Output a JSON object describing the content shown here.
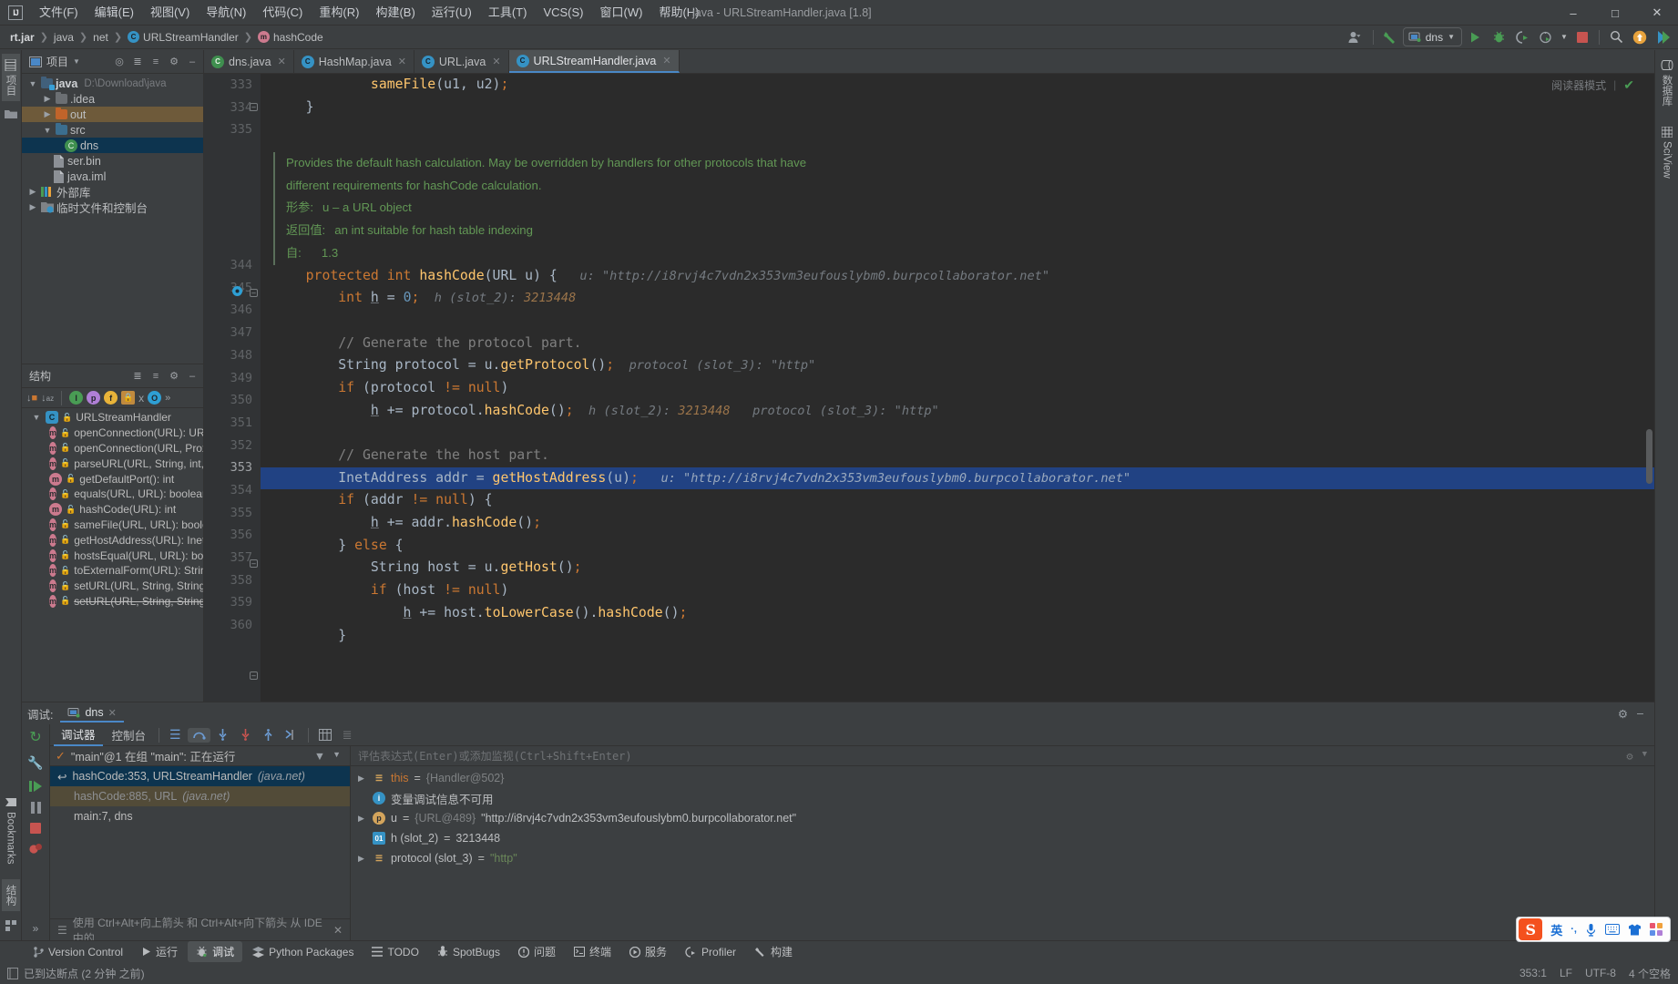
{
  "window": {
    "title": "java - URLStreamHandler.java [1.8]",
    "minimize": "–",
    "maximize": "□",
    "close": "✕"
  },
  "menu": [
    {
      "label": "文件(F)"
    },
    {
      "label": "编辑(E)"
    },
    {
      "label": "视图(V)"
    },
    {
      "label": "导航(N)"
    },
    {
      "label": "代码(C)"
    },
    {
      "label": "重构(R)"
    },
    {
      "label": "构建(B)"
    },
    {
      "label": "运行(U)"
    },
    {
      "label": "工具(T)"
    },
    {
      "label": "VCS(S)"
    },
    {
      "label": "窗口(W)"
    },
    {
      "label": "帮助(H)"
    }
  ],
  "breadcrumbs": [
    {
      "label": "rt.jar",
      "icon": "",
      "bold": true
    },
    {
      "label": "java",
      "icon": "",
      "bold": false
    },
    {
      "label": "net",
      "icon": "",
      "bold": false
    },
    {
      "label": "URLStreamHandler",
      "icon": "C",
      "bold": false
    },
    {
      "label": "hashCode",
      "icon": "m",
      "bold": false
    }
  ],
  "toolbar": {
    "run_config": "dns",
    "run_tooltip": "运行",
    "debug_tooltip": "调试",
    "stop_tooltip": "停止",
    "search_tooltip": "搜索"
  },
  "left_rail": {
    "top": "项目",
    "bookmarks": "Bookmarks",
    "structure": "结构"
  },
  "right_rail": {
    "database": "数据库",
    "sciview": "SciView"
  },
  "project": {
    "title": "项目",
    "rows": [
      {
        "indent": 0,
        "arrow": "v",
        "icon": "folder-module",
        "label": "java",
        "bold": true,
        "path": "D:\\Download\\java",
        "state": ""
      },
      {
        "indent": 1,
        "arrow": ">",
        "icon": "folder",
        "label": ".idea",
        "bold": false,
        "path": "",
        "state": ""
      },
      {
        "indent": 1,
        "arrow": ">",
        "icon": "folder-out",
        "label": "out",
        "bold": false,
        "path": "",
        "state": "sel-orange"
      },
      {
        "indent": 1,
        "arrow": "v",
        "icon": "folder-src",
        "label": "src",
        "bold": false,
        "path": "",
        "state": ""
      },
      {
        "indent": 2,
        "arrow": "",
        "icon": "java-class",
        "label": "dns",
        "bold": false,
        "path": "",
        "state": "sel-blue"
      },
      {
        "indent": 1,
        "arrow": "",
        "icon": "file-bin",
        "label": "ser.bin",
        "bold": false,
        "path": "",
        "state": ""
      },
      {
        "indent": 1,
        "arrow": "",
        "icon": "file-iml",
        "label": "java.iml",
        "bold": false,
        "path": "",
        "state": ""
      },
      {
        "indent": 0,
        "arrow": ">",
        "icon": "library",
        "label": "外部库",
        "bold": false,
        "path": "",
        "state": ""
      },
      {
        "indent": 0,
        "arrow": ">",
        "icon": "scratch",
        "label": "临时文件和控制台",
        "bold": false,
        "path": "",
        "state": ""
      }
    ]
  },
  "structure": {
    "title": "结构",
    "class": "URLStreamHandler",
    "members": [
      {
        "label": "openConnection(URL): URLConnection",
        "strike": false
      },
      {
        "label": "openConnection(URL, Proxy): URLCo",
        "strike": false
      },
      {
        "label": "parseURL(URL, String, int, int): void",
        "strike": false
      },
      {
        "label": "getDefaultPort(): int",
        "strike": false
      },
      {
        "label": "equals(URL, URL): boolean",
        "strike": false
      },
      {
        "label": "hashCode(URL): int",
        "strike": false
      },
      {
        "label": "sameFile(URL, URL): boolean",
        "strike": false
      },
      {
        "label": "getHostAddress(URL): InetAddress",
        "strike": false
      },
      {
        "label": "hostsEqual(URL, URL): boolean",
        "strike": false
      },
      {
        "label": "toExternalForm(URL): String",
        "strike": false
      },
      {
        "label": "setURL(URL, String, String, int, S",
        "strike": false
      },
      {
        "label": "setURL(URL, String, String, int, S",
        "strike": true
      }
    ]
  },
  "editor": {
    "tabs": [
      {
        "label": "dns.java",
        "icon": "green",
        "active": false
      },
      {
        "label": "HashMap.java",
        "icon": "blue",
        "active": false
      },
      {
        "label": "URL.java",
        "icon": "blue",
        "active": false
      },
      {
        "label": "URLStreamHandler.java",
        "icon": "blue",
        "active": true
      }
    ],
    "reader_mode": "阅读器模式",
    "javadoc": {
      "line1": "Provides the default hash calculation. May be overridden by handlers for other protocols that have",
      "line2": "different requirements for hashCode calculation.",
      "param_key": "形参:",
      "param_val": "u – a URL object",
      "return_key": "返回值:",
      "return_val": "an int suitable for hash table indexing",
      "since_key": "自:",
      "since_val": "1.3"
    },
    "lines": [
      {
        "n": "333",
        "text": "            sameFile(u1, u2);"
      },
      {
        "n": "334",
        "text": "    }"
      },
      {
        "n": "335",
        "text": ""
      },
      {
        "n": "344",
        "text": "    protected int hashCode(URL u) {"
      },
      {
        "n": "345",
        "text": "        int h = 0;"
      },
      {
        "n": "346",
        "text": ""
      },
      {
        "n": "347",
        "text": "        // Generate the protocol part."
      },
      {
        "n": "348",
        "text": "        String protocol = u.getProtocol();"
      },
      {
        "n": "349",
        "text": "        if (protocol != null)"
      },
      {
        "n": "350",
        "text": "            h += protocol.hashCode();"
      },
      {
        "n": "351",
        "text": ""
      },
      {
        "n": "352",
        "text": "        // Generate the host part."
      },
      {
        "n": "353",
        "text": "        InetAddress addr = getHostAddress(u);"
      },
      {
        "n": "354",
        "text": "        if (addr != null) {"
      },
      {
        "n": "355",
        "text": "            h += addr.hashCode();"
      },
      {
        "n": "356",
        "text": "        } else {"
      },
      {
        "n": "357",
        "text": "            String host = u.getHost();"
      },
      {
        "n": "358",
        "text": "            if (host != null)"
      },
      {
        "n": "359",
        "text": "                h += host.toLowerCase().hashCode();"
      },
      {
        "n": "360",
        "text": "        }"
      }
    ],
    "inline_hints": {
      "u_label": "u:",
      "u_value": "\"http://i8rvj4c7vdn2x353vm3eufouslybm0.burpcollaborator.net\"",
      "h_label": "h (slot_2):",
      "h_value": "3213448",
      "protocol_label": "protocol (slot_3):",
      "protocol_value": "\"http\""
    }
  },
  "debug": {
    "panel_label": "调试:",
    "session_tab": "dns",
    "tab_debugger": "调试器",
    "tab_console": "控制台",
    "thread_status": "\"main\"@1 在组 \"main\": 正在运行",
    "frames": [
      {
        "label": "hashCode:353, URLStreamHandler",
        "suffix": "(java.net)",
        "state": "sel"
      },
      {
        "label": "hashCode:885, URL",
        "suffix": "(java.net)",
        "state": "lib"
      },
      {
        "label": "main:7, dns",
        "suffix": "",
        "state": ""
      }
    ],
    "eval_placeholder": "评估表达式(Enter)或添加监视(Ctrl+Shift+Enter)",
    "variables": [
      {
        "arrow": ">",
        "icon": "this",
        "iconcolor": "#d3a45c",
        "name": "this",
        "eq": "=",
        "ref": "{Handler@502}",
        "value": "",
        "color": "#cc7832"
      },
      {
        "arrow": "",
        "icon": "info",
        "iconcolor": "#3592c4",
        "name": "变量调试信息不可用",
        "eq": "",
        "ref": "",
        "value": "",
        "color": "#bcbec0"
      },
      {
        "arrow": ">",
        "icon": "param",
        "iconcolor": "#d3a45c",
        "name": "u",
        "eq": "=",
        "ref": "{URL@489}",
        "value": "\"http://i8rvj4c7vdn2x353vm3eufouslybm0.burpcollaborator.net\"",
        "color": "#bcbec0"
      },
      {
        "arrow": "",
        "icon": "prim",
        "iconcolor": "#3592c4",
        "name": "h (slot_2)",
        "eq": "=",
        "ref": "",
        "value": "3213448",
        "color": "#bcbec0"
      },
      {
        "arrow": ">",
        "icon": "this",
        "iconcolor": "#d3a45c",
        "name": "protocol (slot_3)",
        "eq": "=",
        "ref": "",
        "value": "\"http\"",
        "color": "#6a8759"
      }
    ],
    "tip": "使用 Ctrl+Alt+向上箭头 和 Ctrl+Alt+向下箭头 从 IDE 中的...",
    "tip_close": "✕"
  },
  "bottom_tools": [
    {
      "label": "Version Control",
      "icon": "branch",
      "active": false
    },
    {
      "label": "运行",
      "icon": "play",
      "active": false
    },
    {
      "label": "调试",
      "icon": "bug",
      "active": true
    },
    {
      "label": "Python Packages",
      "icon": "pkg",
      "active": false
    },
    {
      "label": "TODO",
      "icon": "list",
      "active": false
    },
    {
      "label": "SpotBugs",
      "icon": "bug2",
      "active": false
    },
    {
      "label": "问题",
      "icon": "warn",
      "active": false
    },
    {
      "label": "终端",
      "icon": "term",
      "active": false
    },
    {
      "label": "服务",
      "icon": "svc",
      "active": false
    },
    {
      "label": "Profiler",
      "icon": "gauge",
      "active": false
    },
    {
      "label": "构建",
      "icon": "hammer",
      "active": false
    }
  ],
  "status": {
    "message": "已到达断点 (2 分钟 之前)",
    "caret": "353:1",
    "line_sep": "LF",
    "encoding": "UTF-8",
    "indent": "4 个空格"
  },
  "ime": {
    "logo": "S",
    "mode": "英",
    "punct": "·,",
    "mic": "mic-icon",
    "keyboard": "keyboard-icon",
    "skin": "skin-icon",
    "apps": "apps-icon"
  },
  "colors": {
    "accent": "#4a88c7",
    "selection": "#214283",
    "green": "#499c54",
    "orange": "#cc7832",
    "string": "#6a8759"
  }
}
